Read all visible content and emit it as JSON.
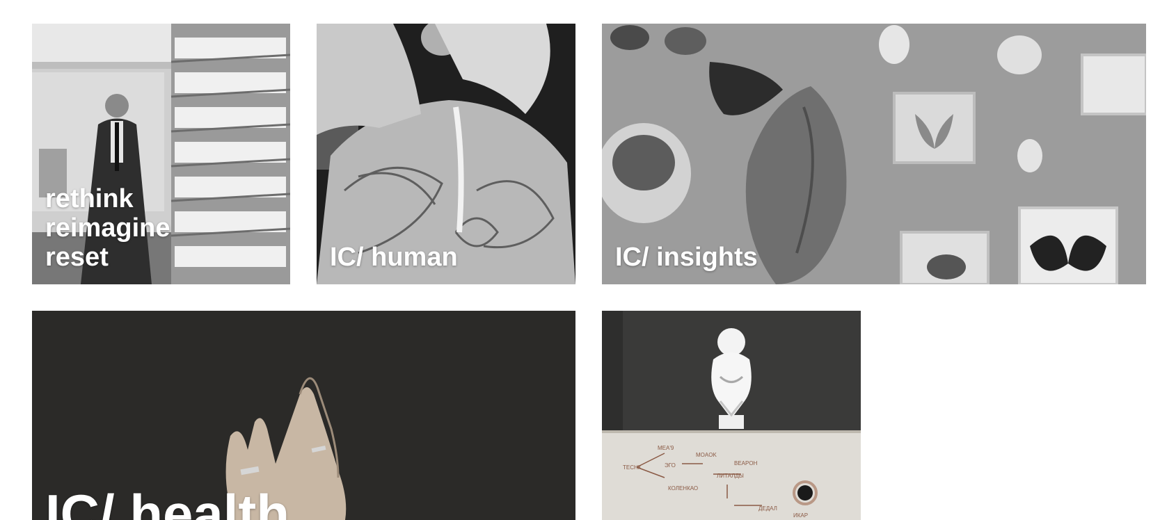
{
  "tiles": [
    {
      "id": "rethink",
      "caption_lines": [
        "rethink",
        "reimagine",
        "reset"
      ],
      "image": "man-in-library-bookshelves"
    },
    {
      "id": "human",
      "caption": "IC/ human",
      "image": "woman-back-tattoo"
    },
    {
      "id": "insights",
      "caption": "IC/ insights",
      "image": "natural-history-specimens-butterflies-shells"
    },
    {
      "id": "health",
      "caption": "IC/ health",
      "image": "hands-with-rings-dark-background"
    },
    {
      "id": "art",
      "caption": "",
      "image": "white-sculpture-bust-with-handwritten-diagram"
    }
  ],
  "colors": {
    "background": "#ffffff",
    "caption": "#ffffff"
  }
}
